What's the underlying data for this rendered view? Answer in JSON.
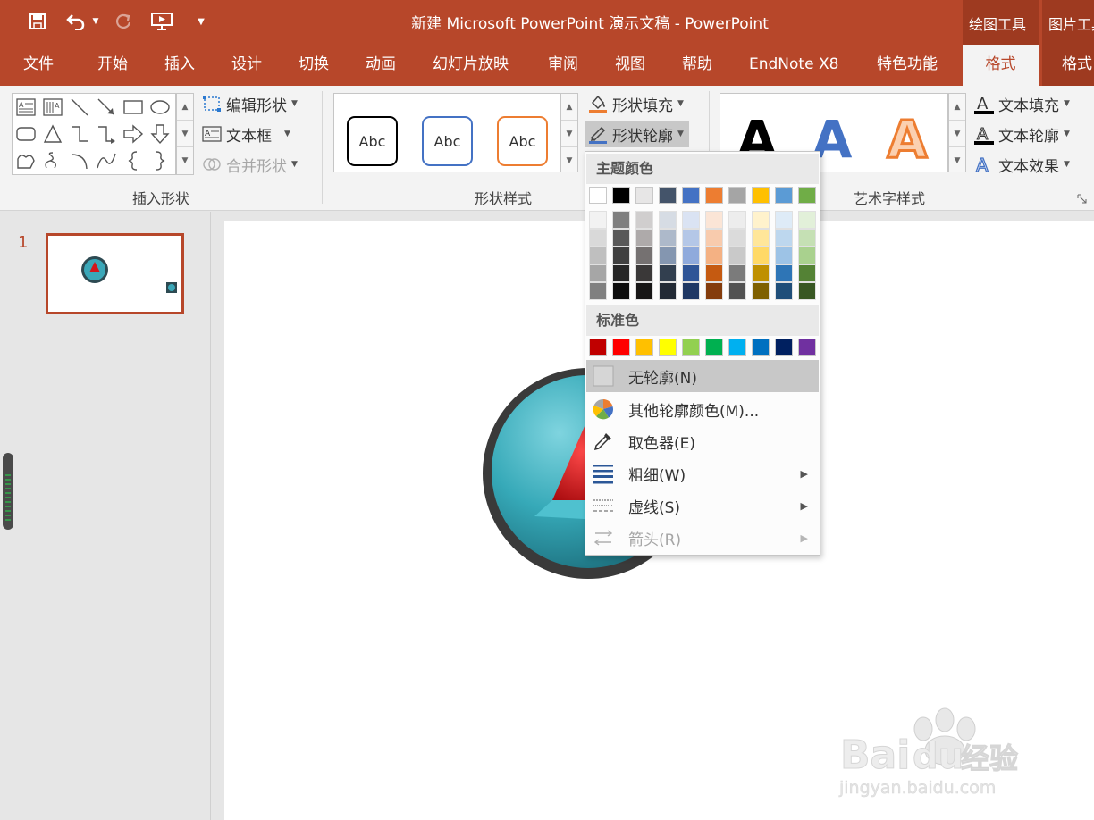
{
  "titlebar": {
    "title": "新建 Microsoft PowerPoint 演示文稿  -  PowerPoint",
    "context_tabs": [
      "绘图工具",
      "图片工具"
    ],
    "icons": [
      "save-icon",
      "undo-icon",
      "undo-dropdown-icon",
      "redo-icon",
      "start-from-beginning-icon",
      "customize-qat-icon"
    ]
  },
  "tabs": [
    "文件",
    "开始",
    "插入",
    "设计",
    "切换",
    "动画",
    "幻灯片放映",
    "审阅",
    "视图",
    "帮助",
    "EndNote X8",
    "特色功能",
    "格式",
    "格式"
  ],
  "active_tab": "格式",
  "ribbon": {
    "insert_shapes": {
      "label": "插入形状",
      "edit_shape": "编辑形状",
      "text_box": "文本框",
      "merge_shapes": "合并形状"
    },
    "shape_styles": {
      "label": "形状样式",
      "samples": [
        "Abc",
        "Abc",
        "Abc"
      ],
      "sample_colors": [
        "#000000",
        "#4472c4",
        "#ed7d31"
      ],
      "shape_fill": "形状填充",
      "shape_outline": "形状轮廓"
    },
    "wordart_styles": {
      "label": "艺术字样式",
      "samples": [
        "A",
        "A",
        "A"
      ],
      "text_fill": "文本填充",
      "text_outline": "文本轮廓",
      "text_effects": "文本效果"
    }
  },
  "slides": {
    "numbers": [
      "1"
    ]
  },
  "outline_menu": {
    "theme_colors_header": "主题颜色",
    "theme_colors": [
      "#ffffff",
      "#000000",
      "#e7e6e6",
      "#44546a",
      "#4472c4",
      "#ed7d31",
      "#a5a5a5",
      "#ffc000",
      "#5b9bd5",
      "#70ad47"
    ],
    "theme_shades": [
      [
        "#f2f2f2",
        "#d9d9d9",
        "#bfbfbf",
        "#a6a6a6",
        "#808080"
      ],
      [
        "#7f7f7f",
        "#595959",
        "#404040",
        "#262626",
        "#0d0d0d"
      ],
      [
        "#d0cece",
        "#aeaaaa",
        "#757171",
        "#3a3838",
        "#171616"
      ],
      [
        "#d6dce4",
        "#adb9ca",
        "#8496b0",
        "#323f4f",
        "#222a35"
      ],
      [
        "#dae3f3",
        "#b4c7e7",
        "#8faadc",
        "#2f5597",
        "#1f3864"
      ],
      [
        "#fbe5d6",
        "#f8cbad",
        "#f4b183",
        "#c55a11",
        "#843c0c"
      ],
      [
        "#ededed",
        "#dbdbdb",
        "#c9c9c9",
        "#7b7b7b",
        "#525252"
      ],
      [
        "#fff2cc",
        "#ffe699",
        "#ffd966",
        "#bf9000",
        "#7f6000"
      ],
      [
        "#deebf7",
        "#bdd7ee",
        "#9dc3e6",
        "#2e75b6",
        "#1f4e79"
      ],
      [
        "#e2f0d9",
        "#c5e0b4",
        "#a9d18e",
        "#548235",
        "#385723"
      ]
    ],
    "standard_colors_header": "标准色",
    "standard_colors": [
      "#c00000",
      "#ff0000",
      "#ffc000",
      "#ffff00",
      "#92d050",
      "#00b050",
      "#00b0f0",
      "#0070c0",
      "#002060",
      "#7030a0"
    ],
    "items": {
      "no_outline": "无轮廓(N)",
      "more_colors": "其他轮廓颜色(M)...",
      "eyedropper": "取色器(E)",
      "weight": "粗细(W)",
      "dashes": "虚线(S)",
      "arrows": "箭头(R)"
    }
  },
  "watermark": {
    "brand": "Bai",
    "brand2": "du",
    "cn": "经验",
    "url": "jingyan.baidu.com"
  }
}
